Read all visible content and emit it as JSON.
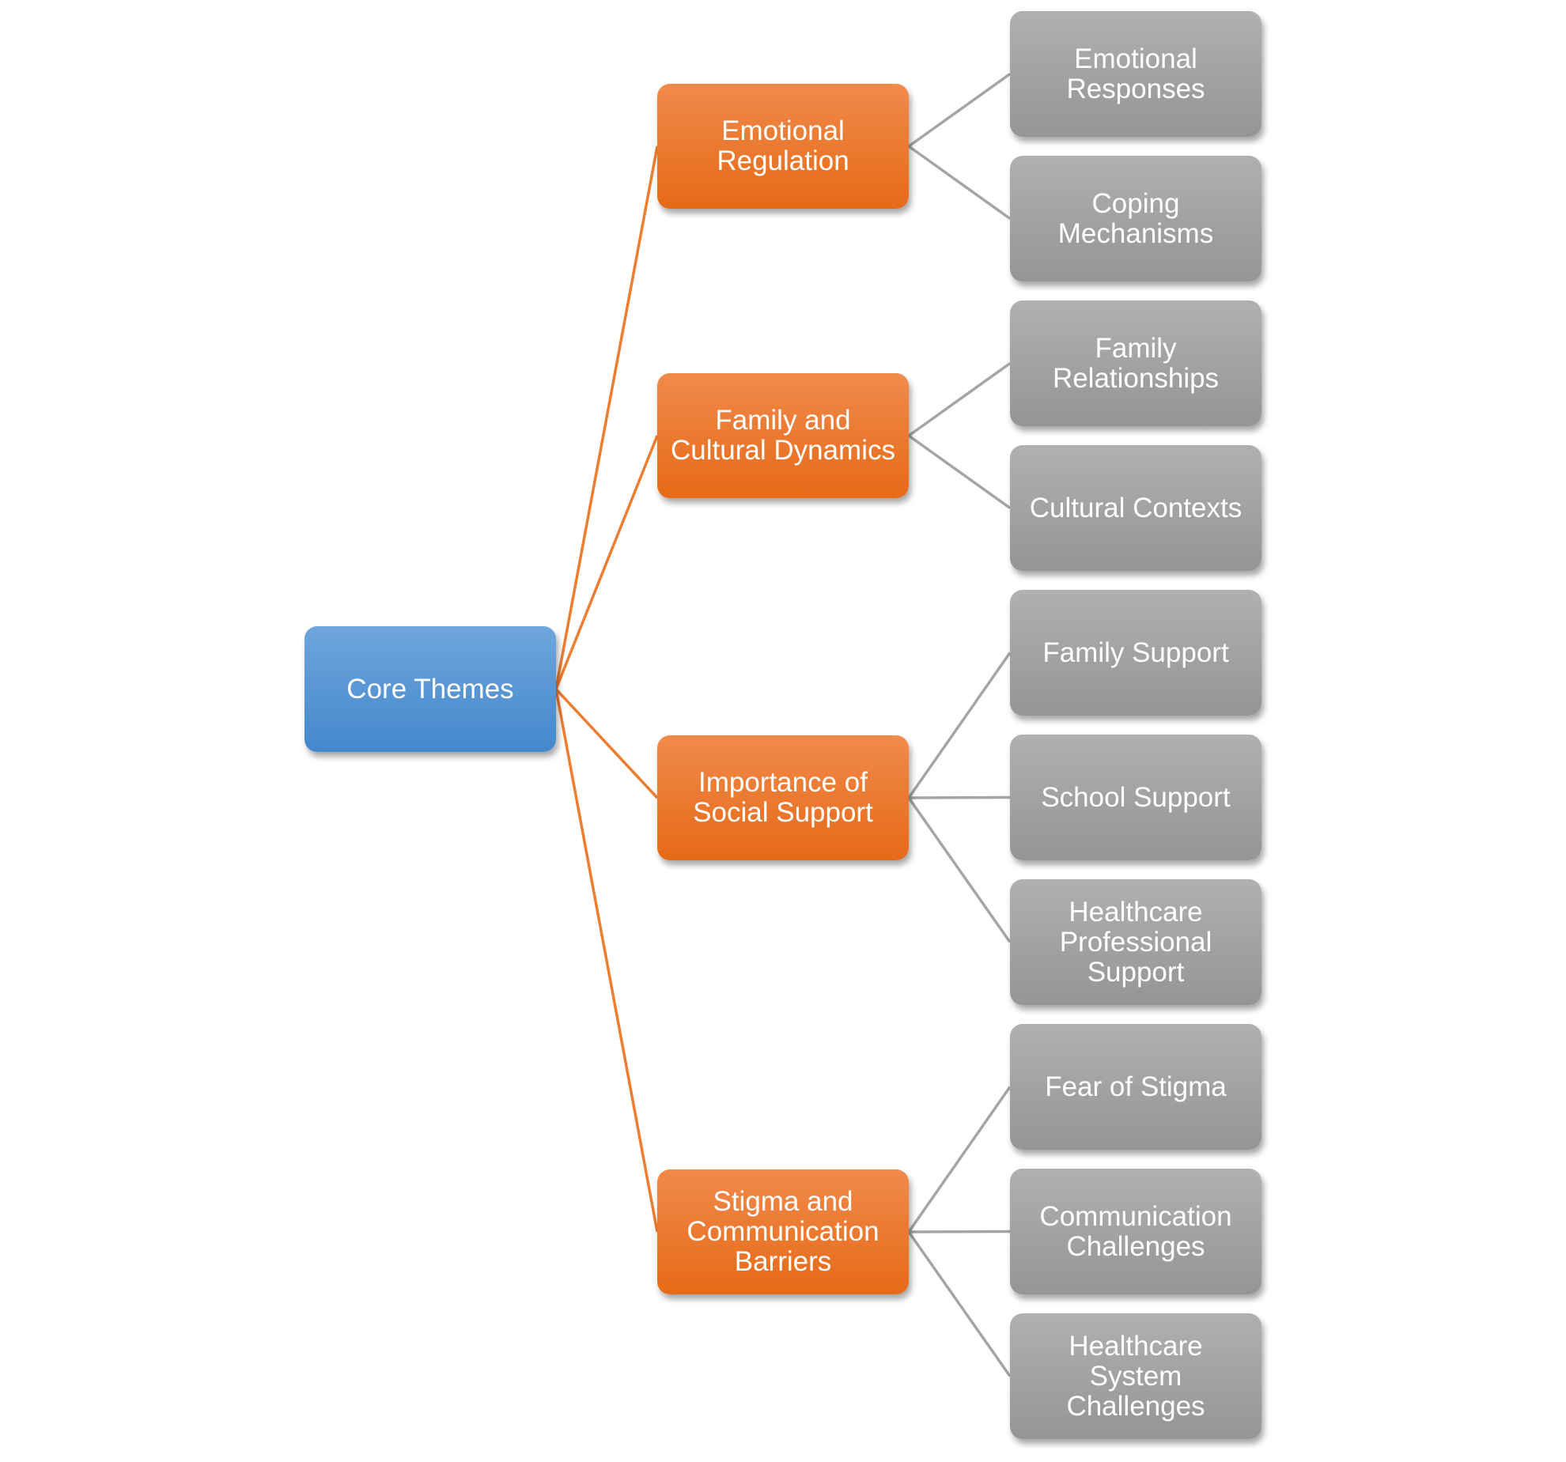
{
  "diagram": {
    "type": "hierarchy",
    "colors": {
      "root": "#5b9bd5",
      "theme": "#ed7d31",
      "subtheme": "#a5a5a5",
      "theme_connector": "#ed7d31",
      "subtheme_connector": "#a5a5a5"
    },
    "root": {
      "label": "Core Themes",
      "children": [
        {
          "label": "Emotional\nRegulation",
          "children": [
            {
              "label": "Emotional\nResponses"
            },
            {
              "label": "Coping\nMechanisms"
            }
          ]
        },
        {
          "label": "Family and\nCultural Dynamics",
          "children": [
            {
              "label": "Family\nRelationships"
            },
            {
              "label": "Cultural Contexts"
            }
          ]
        },
        {
          "label": "Importance of\nSocial Support",
          "children": [
            {
              "label": "Family Support"
            },
            {
              "label": "School Support"
            },
            {
              "label": "Healthcare\nProfessional\nSupport"
            }
          ]
        },
        {
          "label": "Stigma and\nCommunication\nBarriers",
          "children": [
            {
              "label": "Fear of Stigma"
            },
            {
              "label": "Communication\nChallenges"
            },
            {
              "label": "Healthcare\nSystem\nChallenges"
            }
          ]
        }
      ]
    }
  }
}
